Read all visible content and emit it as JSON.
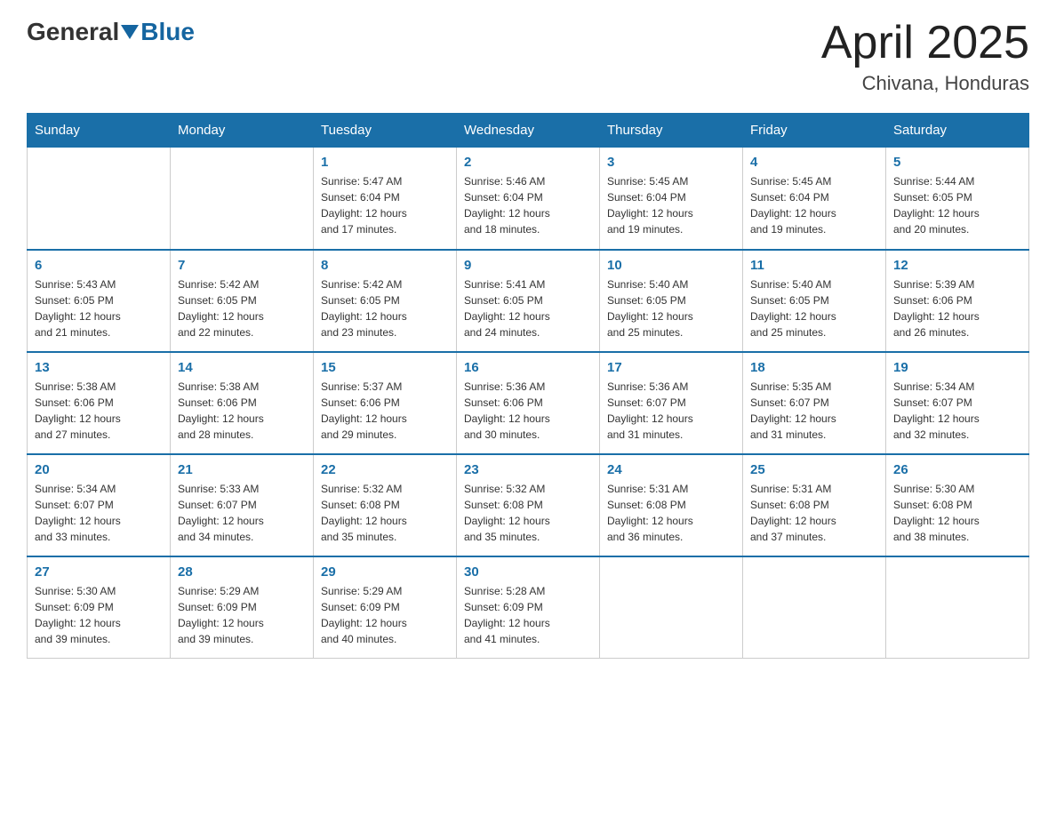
{
  "header": {
    "logo_general": "General",
    "logo_blue": "Blue",
    "month": "April 2025",
    "location": "Chivana, Honduras"
  },
  "weekdays": [
    "Sunday",
    "Monday",
    "Tuesday",
    "Wednesday",
    "Thursday",
    "Friday",
    "Saturday"
  ],
  "weeks": [
    [
      {
        "day": "",
        "info": ""
      },
      {
        "day": "",
        "info": ""
      },
      {
        "day": "1",
        "info": "Sunrise: 5:47 AM\nSunset: 6:04 PM\nDaylight: 12 hours\nand 17 minutes."
      },
      {
        "day": "2",
        "info": "Sunrise: 5:46 AM\nSunset: 6:04 PM\nDaylight: 12 hours\nand 18 minutes."
      },
      {
        "day": "3",
        "info": "Sunrise: 5:45 AM\nSunset: 6:04 PM\nDaylight: 12 hours\nand 19 minutes."
      },
      {
        "day": "4",
        "info": "Sunrise: 5:45 AM\nSunset: 6:04 PM\nDaylight: 12 hours\nand 19 minutes."
      },
      {
        "day": "5",
        "info": "Sunrise: 5:44 AM\nSunset: 6:05 PM\nDaylight: 12 hours\nand 20 minutes."
      }
    ],
    [
      {
        "day": "6",
        "info": "Sunrise: 5:43 AM\nSunset: 6:05 PM\nDaylight: 12 hours\nand 21 minutes."
      },
      {
        "day": "7",
        "info": "Sunrise: 5:42 AM\nSunset: 6:05 PM\nDaylight: 12 hours\nand 22 minutes."
      },
      {
        "day": "8",
        "info": "Sunrise: 5:42 AM\nSunset: 6:05 PM\nDaylight: 12 hours\nand 23 minutes."
      },
      {
        "day": "9",
        "info": "Sunrise: 5:41 AM\nSunset: 6:05 PM\nDaylight: 12 hours\nand 24 minutes."
      },
      {
        "day": "10",
        "info": "Sunrise: 5:40 AM\nSunset: 6:05 PM\nDaylight: 12 hours\nand 25 minutes."
      },
      {
        "day": "11",
        "info": "Sunrise: 5:40 AM\nSunset: 6:05 PM\nDaylight: 12 hours\nand 25 minutes."
      },
      {
        "day": "12",
        "info": "Sunrise: 5:39 AM\nSunset: 6:06 PM\nDaylight: 12 hours\nand 26 minutes."
      }
    ],
    [
      {
        "day": "13",
        "info": "Sunrise: 5:38 AM\nSunset: 6:06 PM\nDaylight: 12 hours\nand 27 minutes."
      },
      {
        "day": "14",
        "info": "Sunrise: 5:38 AM\nSunset: 6:06 PM\nDaylight: 12 hours\nand 28 minutes."
      },
      {
        "day": "15",
        "info": "Sunrise: 5:37 AM\nSunset: 6:06 PM\nDaylight: 12 hours\nand 29 minutes."
      },
      {
        "day": "16",
        "info": "Sunrise: 5:36 AM\nSunset: 6:06 PM\nDaylight: 12 hours\nand 30 minutes."
      },
      {
        "day": "17",
        "info": "Sunrise: 5:36 AM\nSunset: 6:07 PM\nDaylight: 12 hours\nand 31 minutes."
      },
      {
        "day": "18",
        "info": "Sunrise: 5:35 AM\nSunset: 6:07 PM\nDaylight: 12 hours\nand 31 minutes."
      },
      {
        "day": "19",
        "info": "Sunrise: 5:34 AM\nSunset: 6:07 PM\nDaylight: 12 hours\nand 32 minutes."
      }
    ],
    [
      {
        "day": "20",
        "info": "Sunrise: 5:34 AM\nSunset: 6:07 PM\nDaylight: 12 hours\nand 33 minutes."
      },
      {
        "day": "21",
        "info": "Sunrise: 5:33 AM\nSunset: 6:07 PM\nDaylight: 12 hours\nand 34 minutes."
      },
      {
        "day": "22",
        "info": "Sunrise: 5:32 AM\nSunset: 6:08 PM\nDaylight: 12 hours\nand 35 minutes."
      },
      {
        "day": "23",
        "info": "Sunrise: 5:32 AM\nSunset: 6:08 PM\nDaylight: 12 hours\nand 35 minutes."
      },
      {
        "day": "24",
        "info": "Sunrise: 5:31 AM\nSunset: 6:08 PM\nDaylight: 12 hours\nand 36 minutes."
      },
      {
        "day": "25",
        "info": "Sunrise: 5:31 AM\nSunset: 6:08 PM\nDaylight: 12 hours\nand 37 minutes."
      },
      {
        "day": "26",
        "info": "Sunrise: 5:30 AM\nSunset: 6:08 PM\nDaylight: 12 hours\nand 38 minutes."
      }
    ],
    [
      {
        "day": "27",
        "info": "Sunrise: 5:30 AM\nSunset: 6:09 PM\nDaylight: 12 hours\nand 39 minutes."
      },
      {
        "day": "28",
        "info": "Sunrise: 5:29 AM\nSunset: 6:09 PM\nDaylight: 12 hours\nand 39 minutes."
      },
      {
        "day": "29",
        "info": "Sunrise: 5:29 AM\nSunset: 6:09 PM\nDaylight: 12 hours\nand 40 minutes."
      },
      {
        "day": "30",
        "info": "Sunrise: 5:28 AM\nSunset: 6:09 PM\nDaylight: 12 hours\nand 41 minutes."
      },
      {
        "day": "",
        "info": ""
      },
      {
        "day": "",
        "info": ""
      },
      {
        "day": "",
        "info": ""
      }
    ]
  ]
}
